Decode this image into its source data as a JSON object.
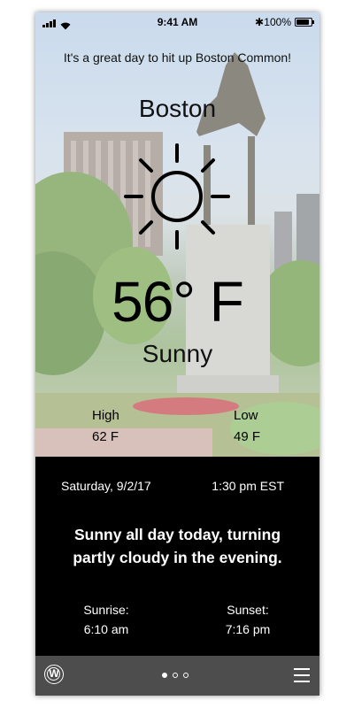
{
  "status_bar": {
    "time": "9:41 AM",
    "battery": "100%",
    "bluetooth_icon": "bluetooth-icon",
    "signal_icon": "signal-bars-icon",
    "wifi_icon": "wifi-icon",
    "battery_icon": "battery-icon"
  },
  "tagline": "It's a great day to hit up Boston Common!",
  "location": {
    "city": "Boston"
  },
  "current": {
    "icon": "sun-icon",
    "temperature": "56° F",
    "condition": "Sunny"
  },
  "high_low": {
    "high_label": "High",
    "high_value": "62 F",
    "low_label": "Low",
    "low_value": "49 F"
  },
  "details": {
    "date": "Saturday, 9/2/17",
    "time": "1:30 pm EST",
    "summary": "Sunny all day today, turning partly cloudy in the evening.",
    "sunrise_label": "Sunrise:",
    "sunrise_time": "6:10 am",
    "sunset_label": "Sunset:",
    "sunset_time": "7:16 pm"
  },
  "bottom_bar": {
    "logo_letter": "W",
    "page_count": 3,
    "active_page": 1,
    "menu_icon": "hamburger-menu-icon"
  },
  "colors": {
    "panel_bg": "#000000",
    "bottom_bar_bg": "#4d4d4d",
    "text_light": "#ffffff",
    "text_dark": "#111111"
  }
}
